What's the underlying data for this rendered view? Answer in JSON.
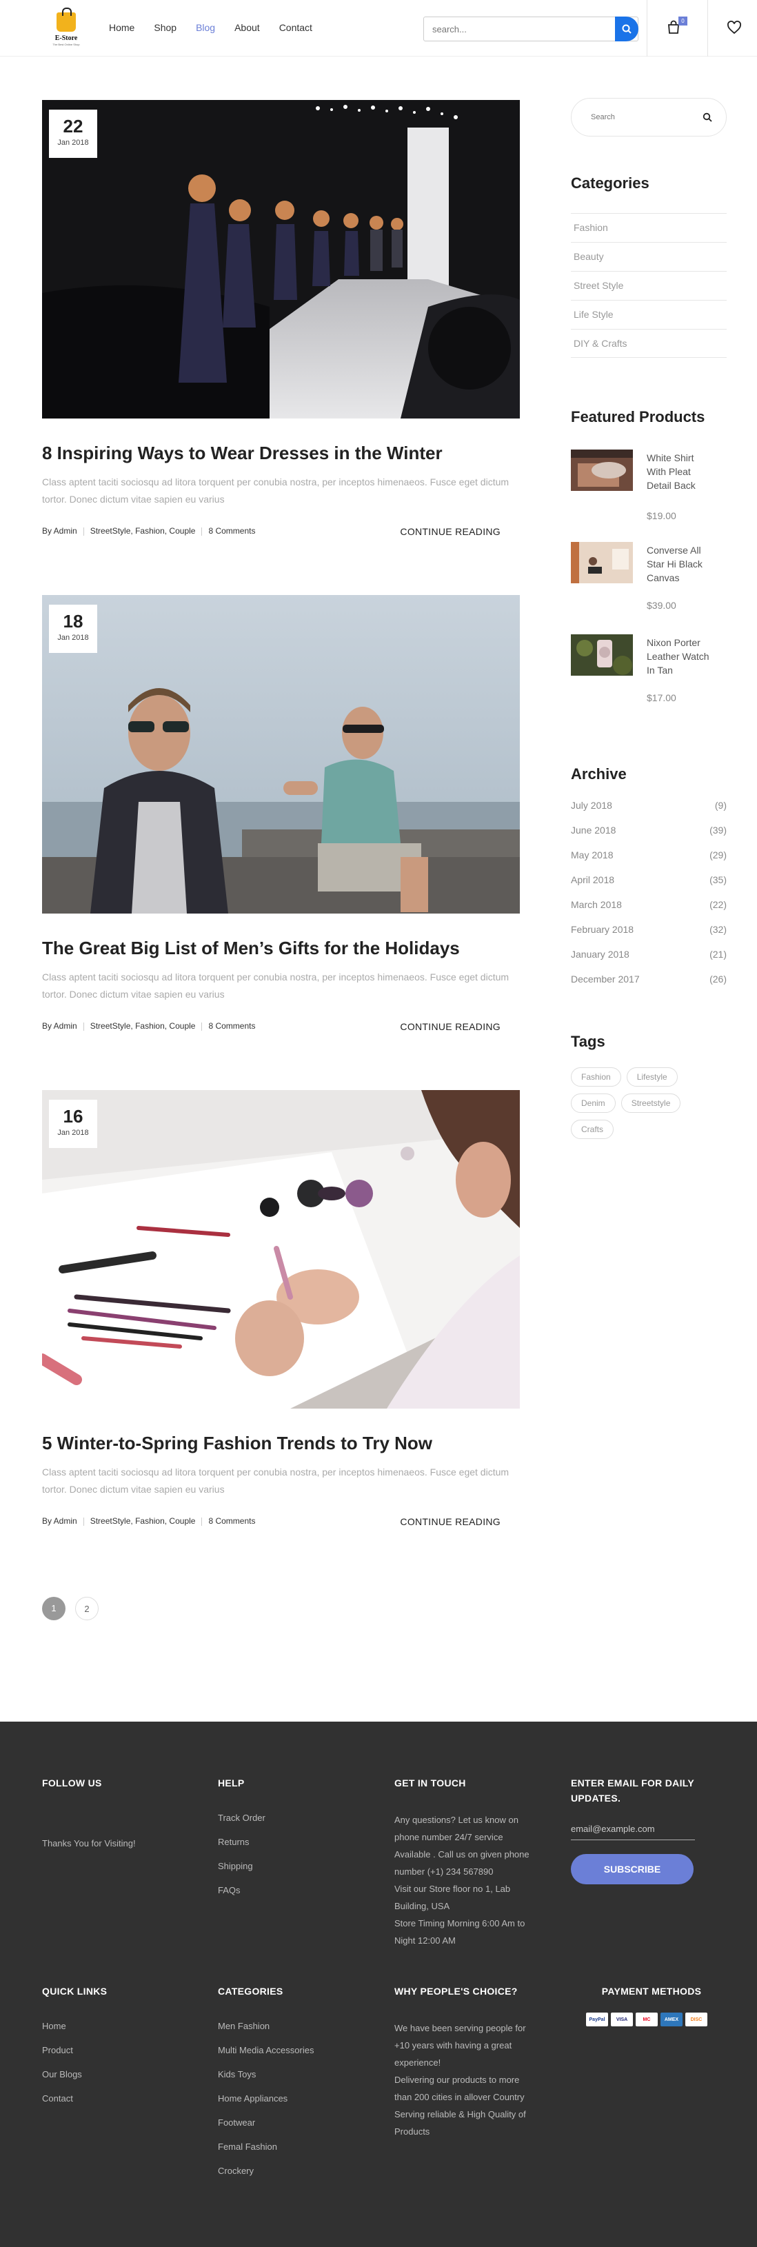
{
  "header": {
    "logo_text": "E-Store",
    "logo_tagline": "The Best Online Shop",
    "nav": [
      {
        "label": "Home"
      },
      {
        "label": "Shop"
      },
      {
        "label": "Blog"
      },
      {
        "label": "About"
      },
      {
        "label": "Contact"
      }
    ],
    "search_placeholder": "search...",
    "cart_count": "0",
    "accent_color": "#6b7fd7",
    "search_button_color": "#1a73e8"
  },
  "posts": [
    {
      "day": "22",
      "month_year": "Jan 2018",
      "title": "8 Inspiring Ways to Wear Dresses in the Winter",
      "excerpt": "Class aptent taciti sociosqu ad litora torquent per conubia nostra, per inceptos himenaeos. Fusce eget dictum tortor. Donec dictum vitae sapien eu varius",
      "author": "By Admin",
      "tags": "StreetStyle, Fashion, Couple",
      "comments": "8 Comments",
      "continue": "CONTINUE READING"
    },
    {
      "day": "18",
      "month_year": "Jan 2018",
      "title": "The Great Big List of Men’s Gifts for the Holidays",
      "excerpt": "Class aptent taciti sociosqu ad litora torquent per conubia nostra, per inceptos himenaeos. Fusce eget dictum tortor. Donec dictum vitae sapien eu varius",
      "author": "By Admin",
      "tags": "StreetStyle, Fashion, Couple",
      "comments": "8 Comments",
      "continue": "CONTINUE READING"
    },
    {
      "day": "16",
      "month_year": "Jan 2018",
      "title": "5 Winter-to-Spring Fashion Trends to Try Now",
      "excerpt": "Class aptent taciti sociosqu ad litora torquent per conubia nostra, per inceptos himenaeos. Fusce eget dictum tortor. Donec dictum vitae sapien eu varius",
      "author": "By Admin",
      "tags": "StreetStyle, Fashion, Couple",
      "comments": "8 Comments",
      "continue": "CONTINUE READING"
    }
  ],
  "pagination": [
    "1",
    "2"
  ],
  "sidebar": {
    "search_placeholder": "Search",
    "categories_title": "Categories",
    "categories": [
      "Fashion",
      "Beauty",
      "Street Style",
      "Life Style",
      "DIY & Crafts"
    ],
    "featured_title": "Featured Products",
    "featured": [
      {
        "name": "White Shirt With Pleat Detail Back",
        "price": "$19.00"
      },
      {
        "name": "Converse All Star Hi Black Canvas",
        "price": "$39.00"
      },
      {
        "name": "Nixon Porter Leather Watch In Tan",
        "price": "$17.00"
      }
    ],
    "archive_title": "Archive",
    "archive": [
      {
        "month": "July 2018",
        "count": "(9)"
      },
      {
        "month": "June 2018",
        "count": "(39)"
      },
      {
        "month": "May 2018",
        "count": "(29)"
      },
      {
        "month": "April 2018",
        "count": "(35)"
      },
      {
        "month": "March 2018",
        "count": "(22)"
      },
      {
        "month": "February 2018",
        "count": "(32)"
      },
      {
        "month": "January 2018",
        "count": "(21)"
      },
      {
        "month": "December 2017",
        "count": "(26)"
      }
    ],
    "tags_title": "Tags",
    "tags": [
      "Fashion",
      "Lifestyle",
      "Denim",
      "Streetstyle",
      "Crafts"
    ]
  },
  "footer": {
    "follow_title": "FOLLOW US",
    "follow_text": "Thanks You for Visiting!",
    "help_title": "HELP",
    "help_links": [
      "Track Order",
      "Returns",
      "Shipping",
      "FAQs"
    ],
    "touch_title": "GET IN TOUCH",
    "touch_lines": [
      "Any questions? Let us know on",
      "phone number 24/7 service",
      "Available . Call us on given phone",
      "number (+1) 234 567890",
      "Visit our Store floor no 1, Lab",
      "Building, USA",
      "Store Timing Morning 6:00 Am to",
      "Night 12:00 AM"
    ],
    "email_title": "ENTER EMAIL FOR DAILY UPDATES.",
    "email_placeholder": "email@example.com",
    "subscribe_label": "SUBSCRIBE",
    "quick_title": "QUICK LINKS",
    "quick_links": [
      "Home",
      "Product",
      "Our Blogs",
      "Contact"
    ],
    "categories_title": "CATEGORIES",
    "categories": [
      "Men Fashion",
      "Multi Media Accessories",
      "Kids Toys",
      "Home Appliances",
      "Footwear",
      "Femal Fashion",
      "Crockery"
    ],
    "why_title": "WHY PEOPLE'S CHOICE?",
    "why_lines": [
      "We have been serving people for",
      "+10 years with having a great",
      "experience!",
      "Delivering our products to more",
      "than 200 cities in allover Country",
      "Serving reliable & High Quality of",
      "Products"
    ],
    "payment_title": "PAYMENT METHODS",
    "payment_cards": [
      "PayPal",
      "VISA",
      "MC",
      "AMEX",
      "DISC"
    ]
  }
}
